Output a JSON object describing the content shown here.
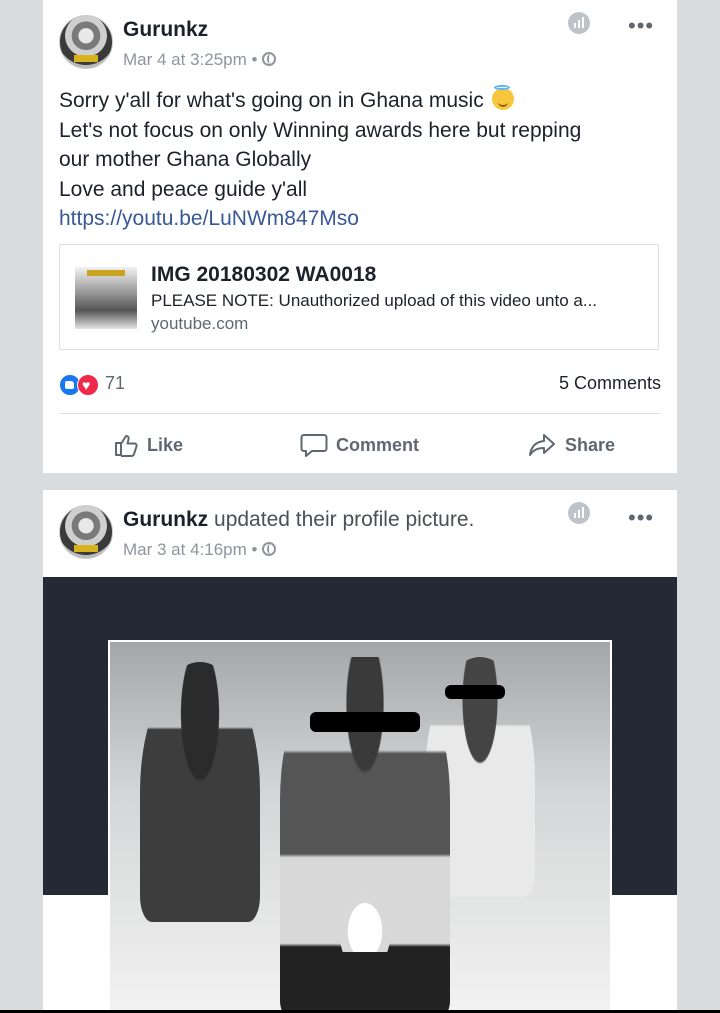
{
  "posts": [
    {
      "author": "Gurunkz",
      "action": "",
      "timestamp": "Mar 4 at 3:25pm",
      "separator": "•",
      "privacy_icon": "globe-icon",
      "text_lines": [
        "Sorry y'all for what's going on in Ghana music",
        "Let's not focus on only Winning awards here but repping",
        "our mother Ghana Globally",
        "Love and peace guide y'all"
      ],
      "emoji": "smiling-face-with-halo",
      "link": "https://youtu.be/LuNWm847Mso",
      "preview": {
        "title": "IMG 20180302 WA0018",
        "description": "PLEASE NOTE: Unauthorized upload of this video unto a...",
        "domain": "youtube.com"
      },
      "reaction_count": "71",
      "reaction_icons": [
        "like-reaction-icon",
        "love-reaction-icon"
      ],
      "comments": "5 Comments",
      "actions": {
        "like": "Like",
        "comment": "Comment",
        "share": "Share"
      }
    },
    {
      "author": "Gurunkz",
      "action": "updated their profile picture.",
      "timestamp": "Mar 3 at 4:16pm",
      "separator": "•",
      "privacy_icon": "globe-icon"
    }
  ],
  "colors": {
    "background": "#d9dcdf",
    "link": "#385898",
    "like_blue": "#1877f2",
    "love_red": "#f0284a",
    "cover_dark": "#232a36"
  }
}
